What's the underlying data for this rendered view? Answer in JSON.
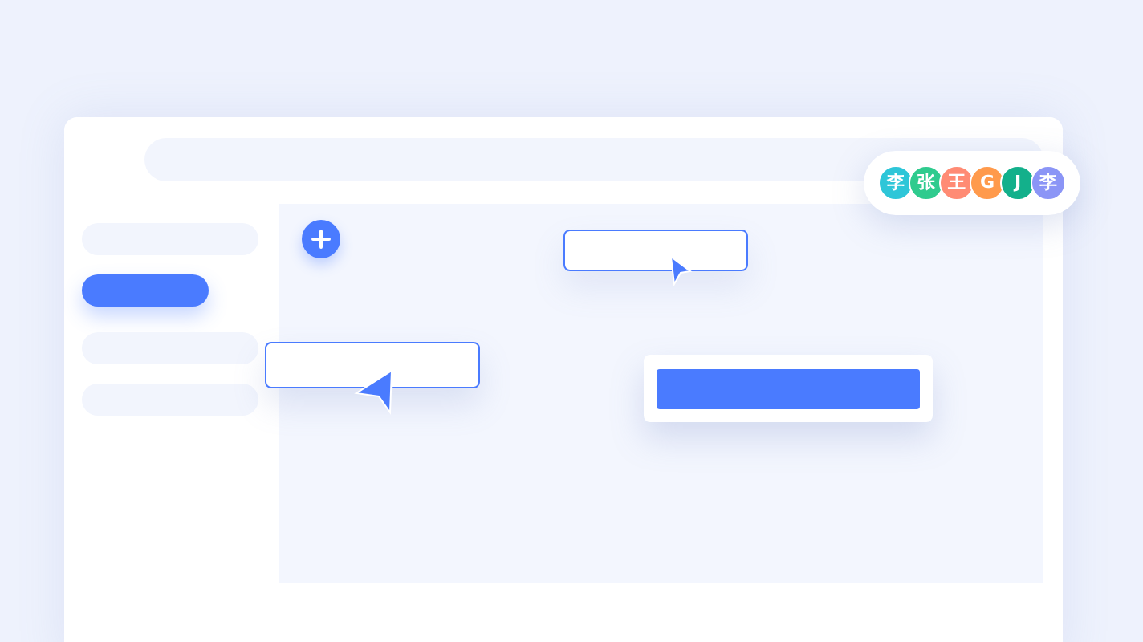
{
  "sidebar": {
    "items": [
      {
        "selected": false
      },
      {
        "selected": true
      },
      {
        "selected": false
      },
      {
        "selected": false
      }
    ]
  },
  "collaborators": [
    {
      "label": "李",
      "color": "#2ec6d8"
    },
    {
      "label": "张",
      "color": "#2fcb8e"
    },
    {
      "label": "王",
      "color": "#ff8b74"
    },
    {
      "label": "G",
      "color": "#ff9a4c"
    },
    {
      "label": "J",
      "color": "#13b08b"
    },
    {
      "label": "李",
      "color": "#8b95f6"
    }
  ]
}
